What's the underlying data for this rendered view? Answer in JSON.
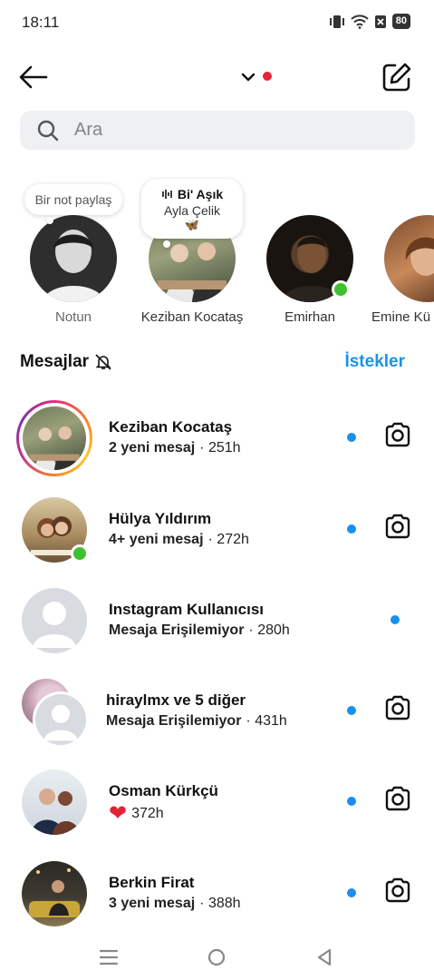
{
  "status": {
    "time": "18:11",
    "battery": "80"
  },
  "search": {
    "placeholder": "Ara"
  },
  "notes": [
    {
      "bubble": "Bir not paylaş",
      "name": "Notun"
    },
    {
      "bubble_title": "Bi' Aşık",
      "bubble_artist": "Ayla Çelik",
      "bubble_emoji": "🦋",
      "name": "Keziban Kocataş"
    },
    {
      "name": "Emirhan",
      "online": true
    },
    {
      "name": "Emine Kü"
    }
  ],
  "messages": {
    "title": "Mesajlar",
    "requests": "İstekler"
  },
  "threads": [
    {
      "name": "Keziban Kocataş",
      "status": "2 yeni mesaj",
      "time": "· 251h",
      "status_bold": true,
      "has_story": true
    },
    {
      "name": "Hülya Yıldırım",
      "status": "4+ yeni mesaj",
      "time": "· 272h",
      "status_bold": true,
      "online": true
    },
    {
      "name": "Instagram Kullanıcısı",
      "status": "Mesaja Erişilemiyor",
      "time": "· 280h",
      "status_bold": true
    },
    {
      "name": "hiraylmx ve 5 diğer",
      "status": "Mesaja Erişilemiyor",
      "time": "· 431h",
      "status_bold": true
    },
    {
      "name": "Osman Kürkçü",
      "status": "❤",
      "time": "372h",
      "status_bold": false
    },
    {
      "name": "Berkin Firat",
      "status": "3 yeni mesaj",
      "time": "· 388h",
      "status_bold": true
    }
  ],
  "colors": {
    "accent": "#1a93e6",
    "unread": "#1a8ff0",
    "online": "#3ec12e",
    "notification": "#e8213a",
    "search_bg": "#eff0f2"
  }
}
